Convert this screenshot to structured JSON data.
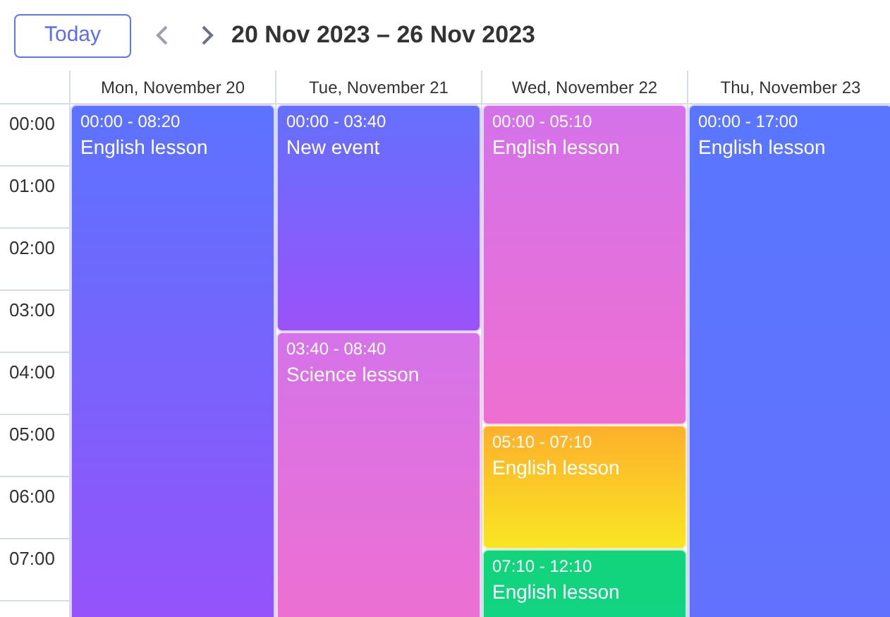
{
  "toolbar": {
    "today_button": "Today",
    "range_title": "20 Nov 2023 – 26 Nov 2023"
  },
  "hours": [
    "00:00",
    "01:00",
    "02:00",
    "03:00",
    "04:00",
    "05:00",
    "06:00",
    "07:00"
  ],
  "days": [
    {
      "label": "Mon, November 20",
      "events": [
        {
          "time": "00:00 - 08:20",
          "title": "English lesson",
          "color": "#5b73fe"
        }
      ]
    },
    {
      "label": "Tue, November 21",
      "events": [
        {
          "time": "00:00 - 03:40",
          "title": "New event",
          "color": "#6470fc"
        },
        {
          "time": "03:40 - 08:40",
          "title": "Science lesson",
          "color": "#d573e9"
        }
      ]
    },
    {
      "label": "Wed, November 22",
      "events": [
        {
          "time": "00:00 - 05:10",
          "title": "English lesson",
          "color": "#d472ea"
        },
        {
          "time": "05:10 - 07:10",
          "title": "English lesson",
          "color": "#fdb02a"
        },
        {
          "time": "07:10 - 12:10",
          "title": "English lesson",
          "color": "#11d47b"
        }
      ]
    },
    {
      "label": "Thu, November 23",
      "events": [
        {
          "time": "00:00 - 17:00",
          "title": "English lesson",
          "color": "#5a76ff"
        }
      ]
    }
  ]
}
